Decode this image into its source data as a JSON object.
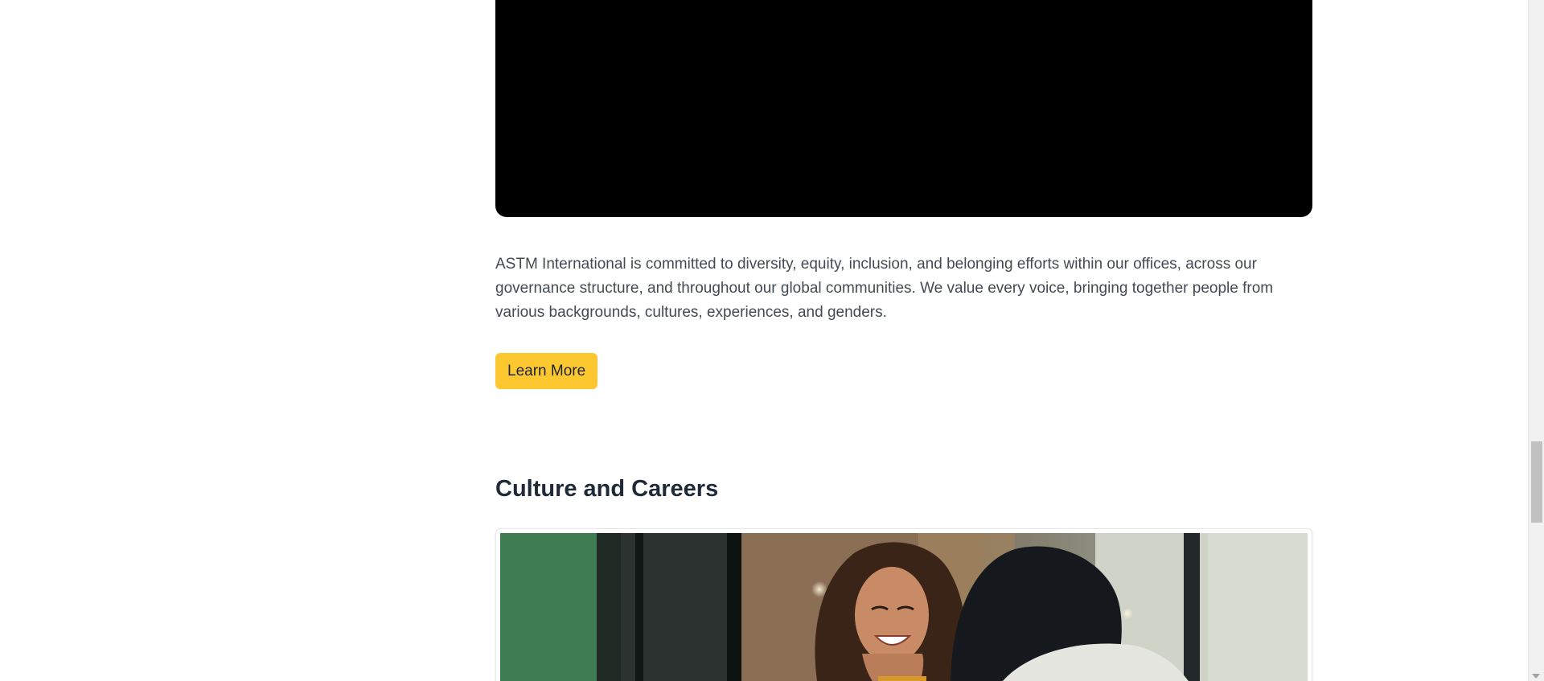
{
  "intro": {
    "text": "ASTM International is committed to diversity, equity, inclusion, and belonging efforts within our offices, across our governance structure, and throughout our global communities. We value every voice, bringing together people from various backgrounds, cultures, experiences, and genders."
  },
  "learn_more": {
    "label": "Learn More",
    "color": "#fdc82f"
  },
  "culture_section": {
    "title": "Culture and Careers"
  },
  "colors": {
    "video_background": "#000000",
    "body_text": "#444a52",
    "heading": "#1f2a38"
  }
}
